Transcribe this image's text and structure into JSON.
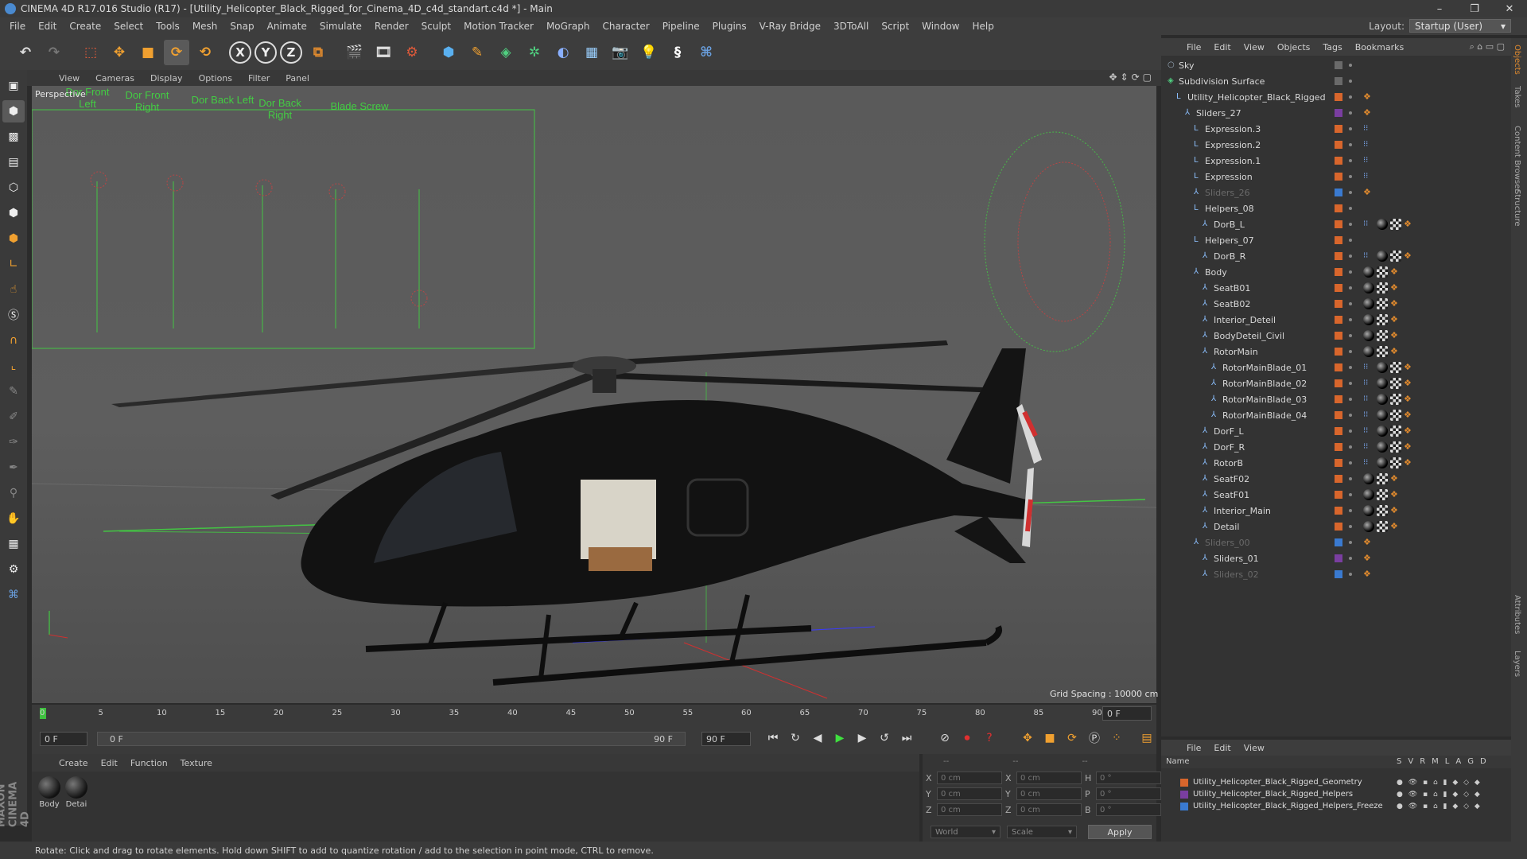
{
  "window": {
    "title": "CINEMA 4D R17.016 Studio (R17) - [Utility_Helicopter_Black_Rigged_for_Cinema_4D_c4d_standart.c4d *] - Main",
    "minimize": "–",
    "maximize": "❐",
    "close": "✕"
  },
  "menubar": {
    "items": [
      "File",
      "Edit",
      "Create",
      "Select",
      "Tools",
      "Mesh",
      "Snap",
      "Animate",
      "Simulate",
      "Render",
      "Sculpt",
      "Motion Tracker",
      "MoGraph",
      "Character",
      "Pipeline",
      "Plugins",
      "V-Ray Bridge",
      "3DToAll",
      "Script",
      "Window",
      "Help"
    ],
    "layout_label": "Layout:",
    "layout_value": "Startup (User)"
  },
  "toolbar": {
    "x_label": "X",
    "y_label": "Y",
    "z_label": "Z"
  },
  "viewport": {
    "menu": [
      "View",
      "Cameras",
      "Display",
      "Options",
      "Filter",
      "Panel"
    ],
    "label": "Perspective",
    "grid_spacing": "Grid Spacing : 10000 cm",
    "slider_labels": [
      "Dor Front Left",
      "Dor Front Right",
      "Dor Back Left",
      "Dor Back Right",
      "Blade Screw"
    ]
  },
  "timeline": {
    "ticks": [
      "0",
      "5",
      "10",
      "15",
      "20",
      "25",
      "30",
      "35",
      "40",
      "45",
      "50",
      "55",
      "60",
      "65",
      "70",
      "75",
      "80",
      "85",
      "90"
    ],
    "current_frame_right": "0 F",
    "start_frame": "0 F",
    "range_start": "0 F",
    "range_end": "90 F",
    "end_frame": "90 F"
  },
  "material_manager": {
    "menu": [
      "Create",
      "Edit",
      "Function",
      "Texture"
    ],
    "materials": [
      "Body",
      "Detai"
    ]
  },
  "coordinates": {
    "header": [
      "--",
      "--",
      "--"
    ],
    "rows": [
      {
        "axis": "X",
        "pos": "0 cm",
        "axis2": "X",
        "size": "0 cm",
        "axis3": "H",
        "rot": "0 °"
      },
      {
        "axis": "Y",
        "pos": "0 cm",
        "axis2": "Y",
        "size": "0 cm",
        "axis3": "P",
        "rot": "0 °"
      },
      {
        "axis": "Z",
        "pos": "0 cm",
        "axis2": "Z",
        "size": "0 cm",
        "axis3": "B",
        "rot": "0 °"
      }
    ],
    "mode": "World",
    "scale": "Scale",
    "apply": "Apply"
  },
  "status": "Rotate: Click and drag to rotate elements. Hold down SHIFT to add to quantize rotation / add to the selection in point mode, CTRL to remove.",
  "object_manager": {
    "menu": [
      "File",
      "Edit",
      "View",
      "Objects",
      "Tags",
      "Bookmarks"
    ],
    "rows": [
      {
        "name": "Sky",
        "indent": 0,
        "type": "sky",
        "color": "grey",
        "tags": []
      },
      {
        "name": "Subdivision Surface",
        "indent": 0,
        "type": "sub",
        "color": "grey",
        "tags": []
      },
      {
        "name": "Utility_Helicopter_Black_Rigged",
        "indent": 1,
        "type": "null",
        "color": "orange",
        "tags": [
          "ora"
        ]
      },
      {
        "name": "Sliders_27",
        "indent": 2,
        "type": "bone",
        "color": "purple",
        "tags": [
          "ora"
        ]
      },
      {
        "name": "Expression.3",
        "indent": 3,
        "type": "null",
        "color": "orange",
        "tags": [
          "expr"
        ]
      },
      {
        "name": "Expression.2",
        "indent": 3,
        "type": "null",
        "color": "orange",
        "tags": [
          "expr"
        ]
      },
      {
        "name": "Expression.1",
        "indent": 3,
        "type": "null",
        "color": "orange",
        "tags": [
          "expr"
        ]
      },
      {
        "name": "Expression",
        "indent": 3,
        "type": "null",
        "color": "orange",
        "tags": [
          "expr"
        ]
      },
      {
        "name": "Sliders_26",
        "indent": 3,
        "type": "bone",
        "color": "blue",
        "dim": true,
        "tags": [
          "ora"
        ]
      },
      {
        "name": "Helpers_08",
        "indent": 3,
        "type": "null",
        "color": "orange",
        "tags": []
      },
      {
        "name": "DorB_L",
        "indent": 4,
        "type": "bone",
        "color": "orange",
        "tags": [
          "expr",
          "ball",
          "chk",
          "ora"
        ]
      },
      {
        "name": "Helpers_07",
        "indent": 3,
        "type": "null",
        "color": "orange",
        "tags": []
      },
      {
        "name": "DorB_R",
        "indent": 4,
        "type": "bone",
        "color": "orange",
        "tags": [
          "expr",
          "ball",
          "chk",
          "ora"
        ]
      },
      {
        "name": "Body",
        "indent": 3,
        "type": "bone",
        "color": "orange",
        "tags": [
          "ball",
          "chk",
          "ora"
        ]
      },
      {
        "name": "SeatB01",
        "indent": 4,
        "type": "bone",
        "color": "orange",
        "tags": [
          "ball",
          "chk",
          "ora"
        ]
      },
      {
        "name": "SeatB02",
        "indent": 4,
        "type": "bone",
        "color": "orange",
        "tags": [
          "ball",
          "chk",
          "ora"
        ]
      },
      {
        "name": "Interior_Deteil",
        "indent": 4,
        "type": "bone",
        "color": "orange",
        "tags": [
          "ball",
          "chk",
          "ora"
        ]
      },
      {
        "name": "BodyDeteil_Civil",
        "indent": 4,
        "type": "bone",
        "color": "orange",
        "tags": [
          "ball",
          "chk",
          "ora"
        ]
      },
      {
        "name": "RotorMain",
        "indent": 4,
        "type": "bone",
        "color": "orange",
        "tags": [
          "ball",
          "chk",
          "ora"
        ]
      },
      {
        "name": "RotorMainBlade_01",
        "indent": 5,
        "type": "bone",
        "color": "orange",
        "tags": [
          "expr",
          "ball",
          "chk",
          "ora"
        ]
      },
      {
        "name": "RotorMainBlade_02",
        "indent": 5,
        "type": "bone",
        "color": "orange",
        "tags": [
          "expr",
          "ball",
          "chk",
          "ora"
        ]
      },
      {
        "name": "RotorMainBlade_03",
        "indent": 5,
        "type": "bone",
        "color": "orange",
        "tags": [
          "expr",
          "ball",
          "chk",
          "ora"
        ]
      },
      {
        "name": "RotorMainBlade_04",
        "indent": 5,
        "type": "bone",
        "color": "orange",
        "tags": [
          "expr",
          "ball",
          "chk",
          "ora"
        ]
      },
      {
        "name": "DorF_L",
        "indent": 4,
        "type": "bone",
        "color": "orange",
        "tags": [
          "expr",
          "ball",
          "chk",
          "ora"
        ]
      },
      {
        "name": "DorF_R",
        "indent": 4,
        "type": "bone",
        "color": "orange",
        "tags": [
          "expr",
          "ball",
          "chk",
          "ora"
        ]
      },
      {
        "name": "RotorB",
        "indent": 4,
        "type": "bone",
        "color": "orange",
        "tags": [
          "expr",
          "ball",
          "chk",
          "ora"
        ]
      },
      {
        "name": "SeatF02",
        "indent": 4,
        "type": "bone",
        "color": "orange",
        "tags": [
          "ball",
          "chk",
          "ora"
        ]
      },
      {
        "name": "SeatF01",
        "indent": 4,
        "type": "bone",
        "color": "orange",
        "tags": [
          "ball",
          "chk",
          "ora"
        ]
      },
      {
        "name": "Interior_Main",
        "indent": 4,
        "type": "bone",
        "color": "orange",
        "tags": [
          "ball",
          "chk",
          "ora"
        ]
      },
      {
        "name": "Detail",
        "indent": 4,
        "type": "bone",
        "color": "orange",
        "tags": [
          "ball",
          "chk",
          "ora"
        ]
      },
      {
        "name": "Sliders_00",
        "indent": 3,
        "type": "bone",
        "color": "blue",
        "dim": true,
        "tags": [
          "ora"
        ]
      },
      {
        "name": "Sliders_01",
        "indent": 4,
        "type": "bone",
        "color": "purple",
        "tags": [
          "ora"
        ]
      },
      {
        "name": "Sliders_02",
        "indent": 4,
        "type": "bone",
        "color": "blue",
        "dim": true,
        "tags": [
          "ora"
        ]
      }
    ]
  },
  "layer_manager": {
    "menu": [
      "File",
      "Edit",
      "View"
    ],
    "header_name": "Name",
    "header_cols": [
      "S",
      "V",
      "R",
      "M",
      "L",
      "A",
      "G",
      "D"
    ],
    "layers": [
      {
        "name": "Utility_Helicopter_Black_Rigged_Geometry",
        "color": "#d8662c"
      },
      {
        "name": "Utility_Helicopter_Black_Rigged_Helpers",
        "color": "#7a3ea0"
      },
      {
        "name": "Utility_Helicopter_Black_Rigged_Helpers_Freeze",
        "color": "#3a7ad0"
      }
    ]
  },
  "right_tabs": [
    "Objects",
    "Takes",
    "Content Browser",
    "Structure",
    "Attributes",
    "Layers"
  ],
  "maxon_logo": "MAXON CINEMA 4D"
}
